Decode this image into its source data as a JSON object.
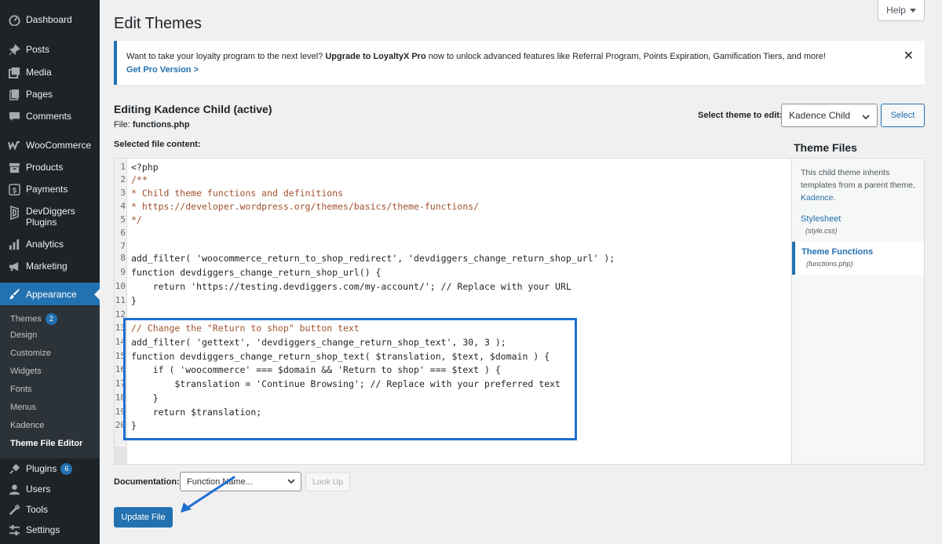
{
  "sidebar": {
    "items": [
      {
        "label": "Dashboard",
        "icon": "dashboard-icon"
      },
      {
        "label": "Posts",
        "icon": "pin-icon"
      },
      {
        "label": "Media",
        "icon": "media-icon"
      },
      {
        "label": "Pages",
        "icon": "pages-icon"
      },
      {
        "label": "Comments",
        "icon": "comment-icon"
      },
      {
        "label": "WooCommerce",
        "icon": "woocommerce-icon"
      },
      {
        "label": "Products",
        "icon": "archive-icon"
      },
      {
        "label": "Payments",
        "icon": "dollar-icon"
      },
      {
        "label": "DevDiggers",
        "label2": "Plugins",
        "icon": "devdiggers-icon"
      },
      {
        "label": "Analytics",
        "icon": "bar-chart-icon"
      },
      {
        "label": "Marketing",
        "icon": "megaphone-icon"
      },
      {
        "label": "Appearance",
        "icon": "brush-icon"
      },
      {
        "label": "Plugins",
        "icon": "plug-icon",
        "badge": "6"
      },
      {
        "label": "Users",
        "icon": "user-icon"
      },
      {
        "label": "Tools",
        "icon": "wrench-icon"
      },
      {
        "label": "Settings",
        "icon": "settings-icon"
      }
    ],
    "submenu": [
      {
        "label": "Themes",
        "badge": "2"
      },
      {
        "label": "Design"
      },
      {
        "label": "Customize"
      },
      {
        "label": "Widgets"
      },
      {
        "label": "Fonts"
      },
      {
        "label": "Menus"
      },
      {
        "label": "Kadence"
      },
      {
        "label": "Theme File Editor"
      }
    ]
  },
  "header": {
    "title": "Edit Themes",
    "help": "Help"
  },
  "notice": {
    "text_pre": "Want to take your loyalty program to the next level? ",
    "text_bold": "Upgrade to LoyaltyX Pro",
    "text_post": " now to unlock advanced features like Referral Program, Points Expiration, Gamification Tiers, and more!",
    "link": "Get Pro Version >",
    "close": "✕"
  },
  "editing": {
    "title": "Editing Kadence Child (active)",
    "file_label": "File: ",
    "file_name": "functions.php",
    "content_label": "Selected file content:",
    "select_label": "Select theme to edit:",
    "select_value": "Kadence Child",
    "select_button": "Select"
  },
  "code_lines": [
    {
      "n": "1",
      "t": "<?php"
    },
    {
      "n": "2",
      "t": "/**"
    },
    {
      "n": "3",
      "t": "* Child theme functions and definitions"
    },
    {
      "n": "4",
      "t": "* https://developer.wordpress.org/themes/basics/theme-functions/"
    },
    {
      "n": "5",
      "t": "*/"
    },
    {
      "n": "6",
      "t": ""
    },
    {
      "n": "7",
      "t": ""
    },
    {
      "n": "8",
      "t": "add_filter( 'woocommerce_return_to_shop_redirect', 'devdiggers_change_return_shop_url' );"
    },
    {
      "n": "9",
      "t": "function devdiggers_change_return_shop_url() {"
    },
    {
      "n": "10",
      "t": "    return 'https://testing.devdiggers.com/my-account/'; // Replace with your URL"
    },
    {
      "n": "11",
      "t": "}"
    },
    {
      "n": "12",
      "t": ""
    },
    {
      "n": "13",
      "t": "// Change the \"Return to shop\" button text"
    },
    {
      "n": "14",
      "t": "add_filter( 'gettext', 'devdiggers_change_return_shop_text', 30, 3 );"
    },
    {
      "n": "15",
      "t": "function devdiggers_change_return_shop_text( $translation, $text, $domain ) {"
    },
    {
      "n": "16",
      "t": "    if ( 'woocommerce' === $domain && 'Return to shop' === $text ) {"
    },
    {
      "n": "17",
      "t": "        $translation = 'Continue Browsing'; // Replace with your preferred text"
    },
    {
      "n": "18",
      "t": "    }"
    },
    {
      "n": "19",
      "t": "    return $translation;"
    },
    {
      "n": "20",
      "t": "}"
    }
  ],
  "theme_files": {
    "title": "Theme Files",
    "desc": "This child theme inherits templates from a parent theme, ",
    "parent_link": "Kadence",
    "files": [
      {
        "name": "Stylesheet",
        "file": "(style.css)"
      },
      {
        "name": "Theme Functions",
        "file": "(functions.php)"
      }
    ]
  },
  "footer": {
    "doc_label": "Documentation:",
    "doc_placeholder": "Function Name...",
    "lookup": "Look Up",
    "update": "Update File"
  },
  "colors": {
    "accent": "#2271b1",
    "sidebar_bg": "#1d2327",
    "highlight_box": "#1e6fd0"
  }
}
